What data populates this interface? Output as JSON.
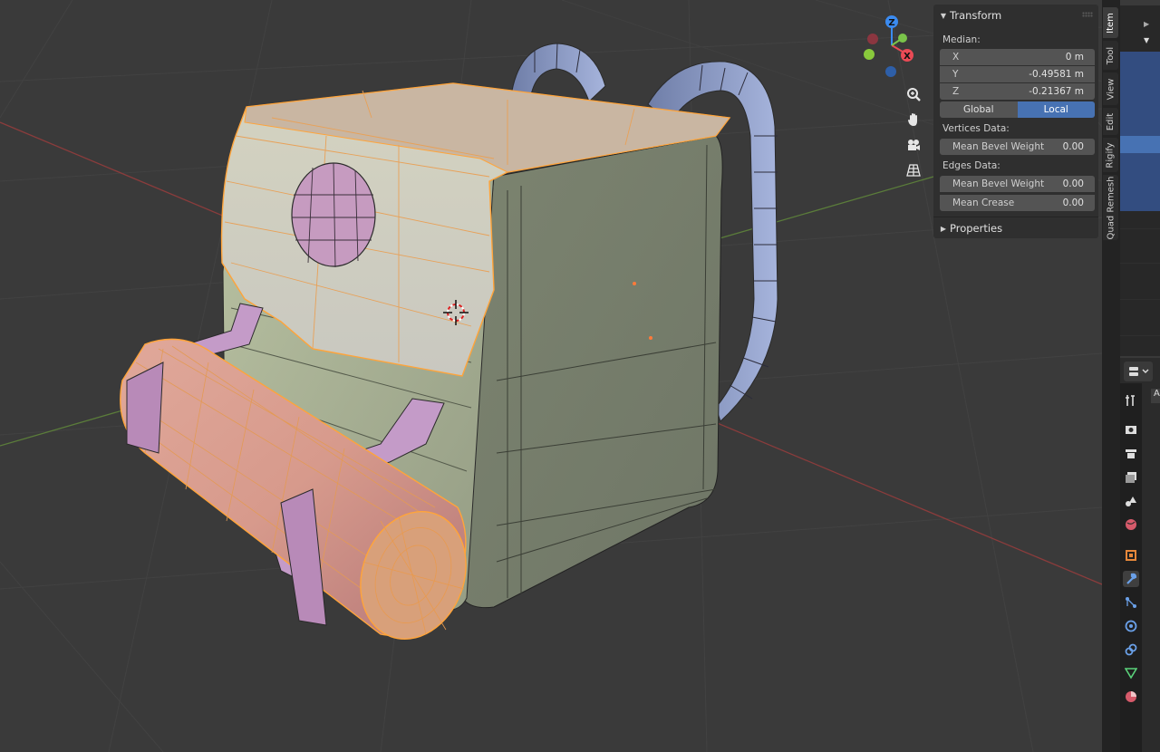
{
  "npanel": {
    "transform_header": "Transform",
    "median_label": "Median:",
    "x": {
      "label": "X",
      "value": "0 m"
    },
    "y": {
      "label": "Y",
      "value": "-0.49581 m"
    },
    "z": {
      "label": "Z",
      "value": "-0.21367 m"
    },
    "space_global": "Global",
    "space_local": "Local",
    "vertices_data_label": "Vertices Data:",
    "vert_bevel": {
      "label": "Mean Bevel Weight",
      "value": "0.00"
    },
    "edges_data_label": "Edges Data:",
    "edge_bevel": {
      "label": "Mean Bevel Weight",
      "value": "0.00"
    },
    "edge_crease": {
      "label": "Mean Crease",
      "value": "0.00"
    },
    "properties_header": "Properties"
  },
  "side_tabs": [
    "Item",
    "Tool",
    "View",
    "Edit",
    "Rigify",
    "Quad Remesh"
  ],
  "gizmo": {
    "z": "Z",
    "x": "X"
  },
  "colors": {
    "accent": "#4772b3",
    "selection": "#ffa43a",
    "x_axis": "#e04a4a",
    "y_axis": "#7ac74a",
    "z_axis": "#4a8fe0"
  },
  "props_icons": [
    "tool-icon",
    "render-icon",
    "output-icon",
    "view-layer-icon",
    "scene-icon",
    "world-icon",
    "object-icon",
    "modifier-icon",
    "particles-icon",
    "physics-icon",
    "constraints-icon",
    "data-icon",
    "material-icon"
  ],
  "props_tab_fragment": "A"
}
